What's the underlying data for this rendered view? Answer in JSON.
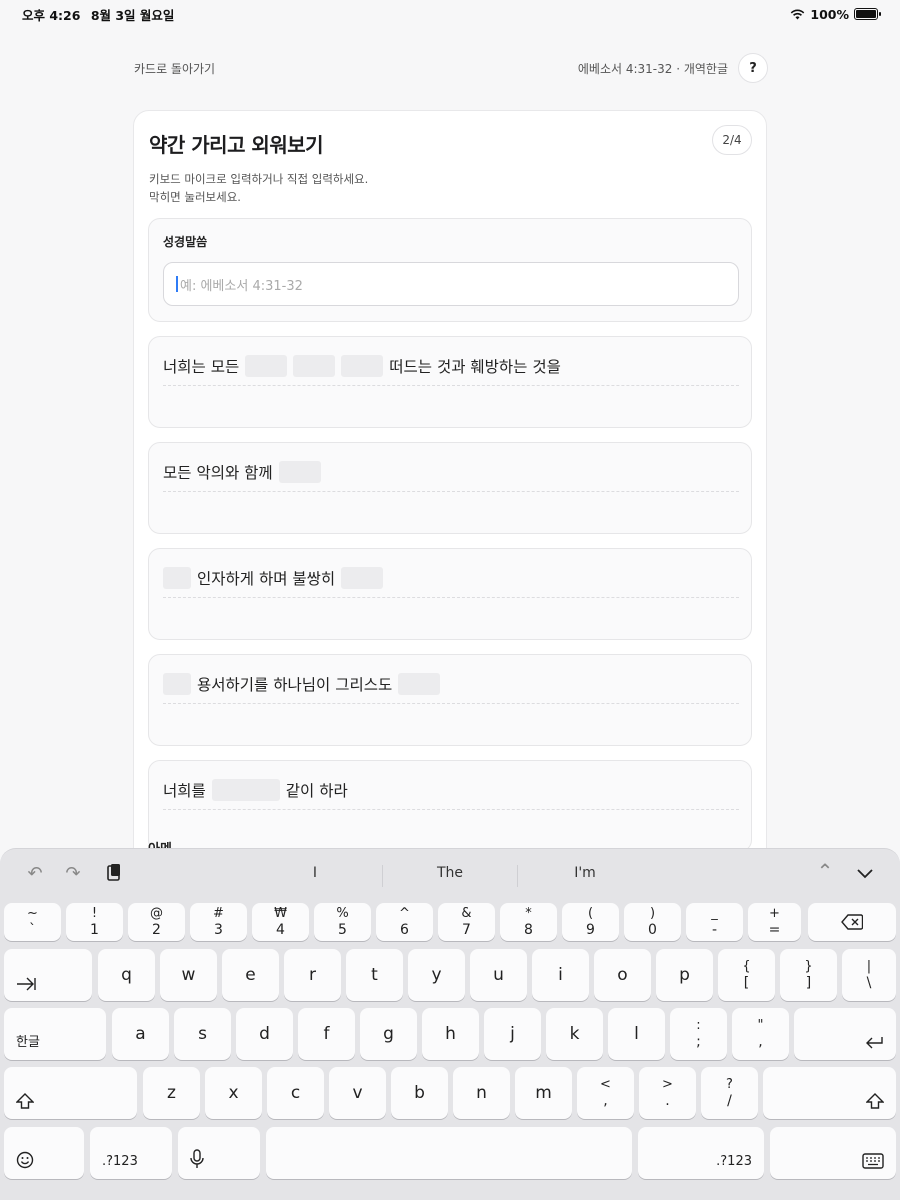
{
  "status_bar": {
    "time": "오후 4:26",
    "date": "8월 3일 월요일",
    "battery": "100%"
  },
  "nav": {
    "back_label": "카드로 돌아가기",
    "verse_info": "에베소서 4:31-32 · 개역한글",
    "help_label": "?"
  },
  "card": {
    "title": "약간 가리고 외워보기",
    "step": "2/4",
    "desc_line1": "키보드 마이크로 입력하거나 직접 입력하세요.",
    "desc_line2": "막히면 눌러보세요.",
    "reference": {
      "label": "성경말씀",
      "placeholder": "예: 에베소서 4:31-32"
    },
    "lines": [
      {
        "parts": [
          "너희는 모든",
          "",
          "",
          "",
          "떠드는 것과 훼방하는 것을"
        ]
      },
      {
        "parts": [
          "모든 악의와 함께",
          ""
        ]
      },
      {
        "parts": [
          "",
          "인자하게 하며 불쌍히",
          ""
        ]
      },
      {
        "parts": [
          "",
          "용서하기를 하나님이 그리스도",
          ""
        ]
      },
      {
        "parts": [
          "너희를",
          "",
          "같이 하라"
        ]
      }
    ],
    "amen_label": "아멘"
  },
  "keyboard": {
    "suggestions": [
      "I",
      "The",
      "I'm"
    ],
    "row1": [
      {
        "top": "~",
        "bot": "`"
      },
      {
        "top": "!",
        "bot": "1"
      },
      {
        "top": "@",
        "bot": "2"
      },
      {
        "top": "#",
        "bot": "3"
      },
      {
        "top": "₩",
        "bot": "4"
      },
      {
        "top": "%",
        "bot": "5"
      },
      {
        "top": "^",
        "bot": "6"
      },
      {
        "top": "&",
        "bot": "7"
      },
      {
        "top": "*",
        "bot": "8"
      },
      {
        "top": "(",
        "bot": "9"
      },
      {
        "top": ")",
        "bot": "0"
      },
      {
        "top": "_",
        "bot": "-"
      },
      {
        "top": "+",
        "bot": "="
      }
    ],
    "row2": [
      "q",
      "w",
      "e",
      "r",
      "t",
      "y",
      "u",
      "i",
      "o",
      "p"
    ],
    "row2_dual": [
      {
        "top": "{",
        "bot": "["
      },
      {
        "top": "}",
        "bot": "]"
      },
      {
        "top": "|",
        "bot": "\\"
      }
    ],
    "row3": [
      "a",
      "s",
      "d",
      "f",
      "g",
      "h",
      "j",
      "k",
      "l"
    ],
    "row3_dual": [
      {
        "top": ":",
        "bot": ";"
      },
      {
        "top": "\"",
        "bot": ","
      }
    ],
    "row4": [
      "z",
      "x",
      "c",
      "v",
      "b",
      "n",
      "m"
    ],
    "row4_dual": [
      {
        "top": "<",
        "bot": ","
      },
      {
        "top": ">",
        "bot": "."
      },
      {
        "top": "?",
        "bot": "/"
      }
    ],
    "lang_key": "한글",
    "num_key": ".?123"
  }
}
